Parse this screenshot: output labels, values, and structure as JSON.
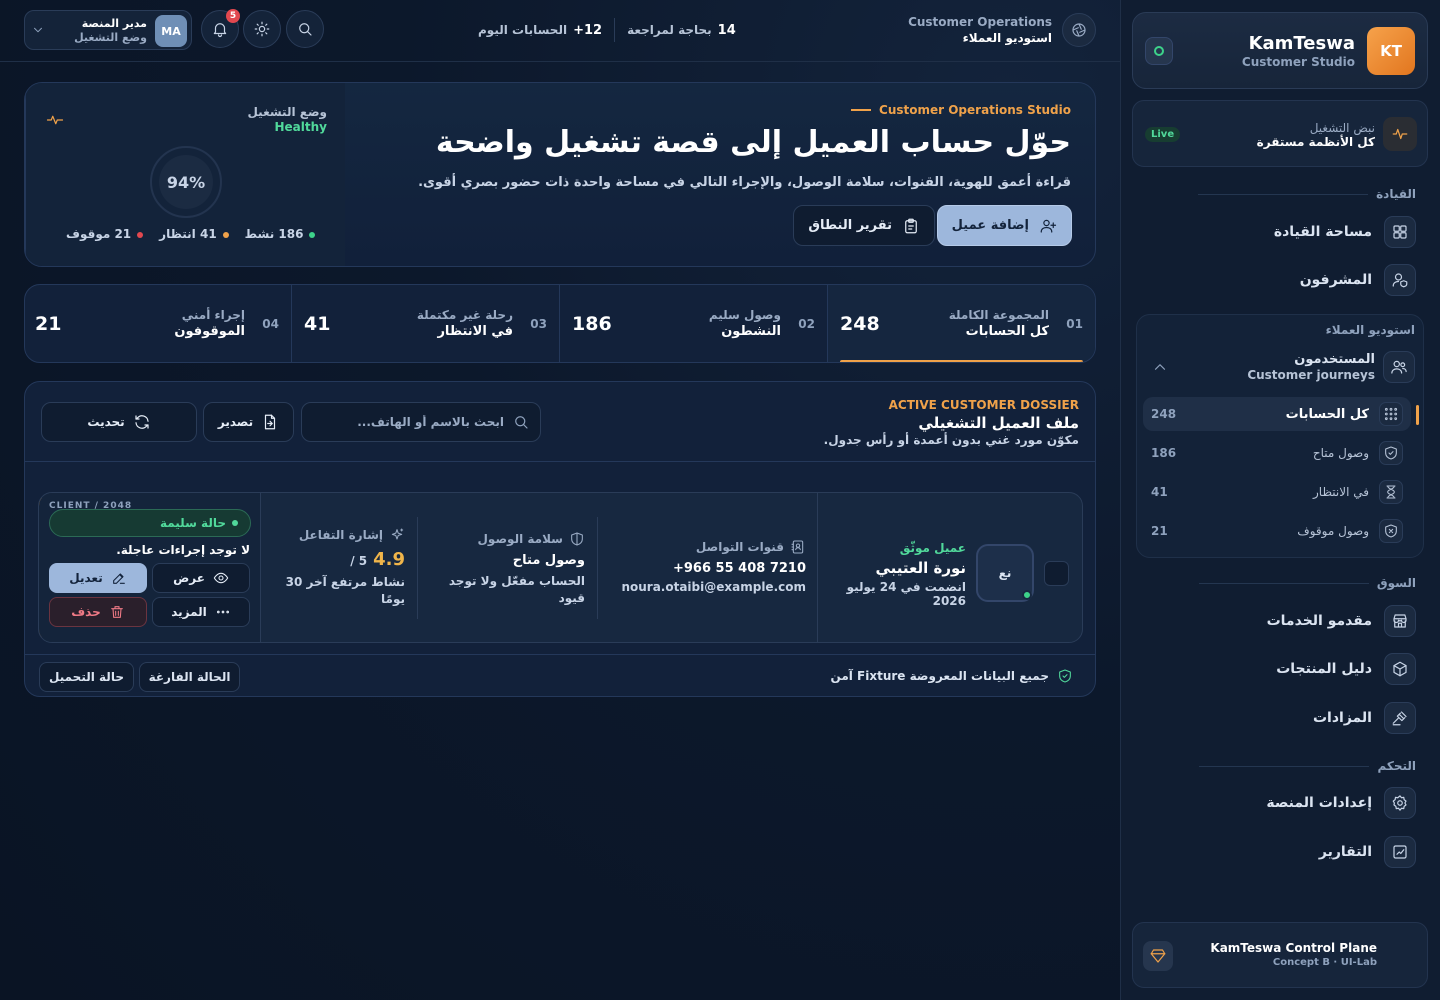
{
  "brand": {
    "logo": "KT",
    "name": "KamTeswa",
    "subtitle": "Customer Studio"
  },
  "pulse": {
    "label": "نبض التشغيل",
    "status": "كل الأنظمة مستقرة",
    "badge": "Live",
    "icon": "pulse-icon"
  },
  "sidebar": {
    "leadership": {
      "title": "القيادة",
      "items": [
        {
          "label": "مساحة القيادة",
          "icon": "dashboard-icon"
        },
        {
          "label": "المشرفون",
          "icon": "user-shield-icon"
        }
      ]
    },
    "studio": {
      "title": "استوديو العملاء",
      "group": {
        "label": "المستخدمون",
        "sub": "Customer journeys",
        "icon": "users-icon"
      },
      "items": [
        {
          "label": "كل الحسابات",
          "count": "248",
          "icon": "grid-icon"
        },
        {
          "label": "وصول متاح",
          "count": "186",
          "icon": "shield-check-icon"
        },
        {
          "label": "في الانتظار",
          "count": "41",
          "icon": "hourglass-icon"
        },
        {
          "label": "وصول موقوف",
          "count": "21",
          "icon": "shield-x-icon"
        }
      ]
    },
    "market": {
      "title": "السوق",
      "items": [
        {
          "label": "مقدمو الخدمات",
          "icon": "store-icon"
        },
        {
          "label": "دليل المنتجات",
          "icon": "box-icon"
        },
        {
          "label": "المزادات",
          "icon": "gavel-icon"
        }
      ]
    },
    "control": {
      "title": "التحكم",
      "items": [
        {
          "label": "إعدادات المنصة",
          "icon": "gear-icon"
        },
        {
          "label": "التقارير",
          "icon": "chart-icon"
        }
      ]
    },
    "footer": {
      "title": "KamTeswa Control Plane",
      "sub": "Concept B · UI-Lab",
      "icon": "diamond-icon"
    }
  },
  "topbar": {
    "workspace": {
      "title": "Customer Operations",
      "sub": "استوديو العملاء"
    },
    "kpi_today_label": "الحسابات اليوم",
    "kpi_today_value": "12+",
    "kpi_review_label": "بحاجة لمراجعة",
    "kpi_review_value": "14",
    "notifications": "5",
    "user": {
      "initials": "MA",
      "role": "مدير المنصة",
      "mode": "وضع التشغيل"
    }
  },
  "hero": {
    "eyebrow": "Customer Operations Studio",
    "title": "حوّل حساب العميل إلى قصة تشغيل واضحة",
    "desc": "قراءة أعمق للهوية، القنوات، سلامة الوصول، والإجراء التالي في مساحة واحدة ذات حضور بصري أقوى.",
    "primary": "إضافة عميل",
    "secondary": "تقرير النطاق",
    "side": {
      "label": "وضع التشغيل",
      "status": "Healthy",
      "percent": "94%",
      "legend": [
        {
          "label": "186 نشط",
          "color": "#3dd28a"
        },
        {
          "label": "41 انتظار",
          "color": "#f0a24a"
        },
        {
          "label": "21 موقوف",
          "color": "#e2484f"
        }
      ]
    }
  },
  "stats": [
    {
      "num": "01",
      "caption": "المجموعة الكاملة",
      "label": "كل الحسابات",
      "value": "248"
    },
    {
      "num": "02",
      "caption": "وصول سليم",
      "label": "النشطون",
      "value": "186"
    },
    {
      "num": "03",
      "caption": "رحلة غير مكتملة",
      "label": "في الانتظار",
      "value": "41"
    },
    {
      "num": "04",
      "caption": "إجراء أمني",
      "label": "الموقوفون",
      "value": "21"
    }
  ],
  "dossier": {
    "eyebrow": "ACTIVE CUSTOMER DOSSIER",
    "title": "ملف العميل التشغيلي",
    "desc": "مكوّن مورد غني بدون أعمدة أو رأس جدول.",
    "search_placeholder": "ابحث بالاسم أو الهاتف...",
    "export": "تصدير",
    "refresh": "تحديث",
    "customer": {
      "initials": "نع",
      "badge": "عميل موثّق",
      "name": "نورة العتيبي",
      "joined": "انضمت في 24 يوليو 2026",
      "channels_title": "قنوات التواصل",
      "phone": "+966 55 408 7210",
      "email": "noura.otaibi@example.com",
      "access_title": "سلامة الوصول",
      "access_status": "وصول متاح",
      "access_desc": "الحساب مفعّل ولا توجد قيود",
      "engagement_title": "إشارة التفاعل",
      "score": "4.9",
      "score_max": "/ 5",
      "engagement_desc": "نشاط مرتفع آخر 30 يومًا",
      "client_id": "CLIENT / 2048",
      "health": "حالة سليمة",
      "note": "لا توجد إجراءات عاجلة.",
      "view": "عرض",
      "edit": "تعديل",
      "more": "المزيد",
      "delete": "حذف"
    },
    "footer_note": "جميع البيانات المعروضة Fixture آمن",
    "empty_state": "الحالة الفارغة",
    "loading_state": "حالة التحميل"
  }
}
